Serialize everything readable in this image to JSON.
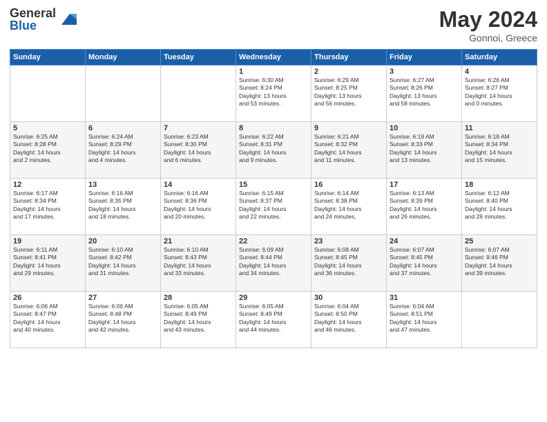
{
  "logo": {
    "general": "General",
    "blue": "Blue"
  },
  "title": "May 2024",
  "location": "Gonnoi, Greece",
  "days_of_week": [
    "Sunday",
    "Monday",
    "Tuesday",
    "Wednesday",
    "Thursday",
    "Friday",
    "Saturday"
  ],
  "weeks": [
    [
      {
        "num": "",
        "info": ""
      },
      {
        "num": "",
        "info": ""
      },
      {
        "num": "",
        "info": ""
      },
      {
        "num": "1",
        "info": "Sunrise: 6:30 AM\nSunset: 8:24 PM\nDaylight: 13 hours\nand 53 minutes."
      },
      {
        "num": "2",
        "info": "Sunrise: 6:29 AM\nSunset: 8:25 PM\nDaylight: 13 hours\nand 56 minutes."
      },
      {
        "num": "3",
        "info": "Sunrise: 6:27 AM\nSunset: 8:26 PM\nDaylight: 13 hours\nand 58 minutes."
      },
      {
        "num": "4",
        "info": "Sunrise: 6:26 AM\nSunset: 8:27 PM\nDaylight: 14 hours\nand 0 minutes."
      }
    ],
    [
      {
        "num": "5",
        "info": "Sunrise: 6:25 AM\nSunset: 8:28 PM\nDaylight: 14 hours\nand 2 minutes."
      },
      {
        "num": "6",
        "info": "Sunrise: 6:24 AM\nSunset: 8:29 PM\nDaylight: 14 hours\nand 4 minutes."
      },
      {
        "num": "7",
        "info": "Sunrise: 6:23 AM\nSunset: 8:30 PM\nDaylight: 14 hours\nand 6 minutes."
      },
      {
        "num": "8",
        "info": "Sunrise: 6:22 AM\nSunset: 8:31 PM\nDaylight: 14 hours\nand 9 minutes."
      },
      {
        "num": "9",
        "info": "Sunrise: 6:21 AM\nSunset: 8:32 PM\nDaylight: 14 hours\nand 11 minutes."
      },
      {
        "num": "10",
        "info": "Sunrise: 6:19 AM\nSunset: 8:33 PM\nDaylight: 14 hours\nand 13 minutes."
      },
      {
        "num": "11",
        "info": "Sunrise: 6:18 AM\nSunset: 8:34 PM\nDaylight: 14 hours\nand 15 minutes."
      }
    ],
    [
      {
        "num": "12",
        "info": "Sunrise: 6:17 AM\nSunset: 8:34 PM\nDaylight: 14 hours\nand 17 minutes."
      },
      {
        "num": "13",
        "info": "Sunrise: 6:16 AM\nSunset: 8:35 PM\nDaylight: 14 hours\nand 18 minutes."
      },
      {
        "num": "14",
        "info": "Sunrise: 6:16 AM\nSunset: 8:36 PM\nDaylight: 14 hours\nand 20 minutes."
      },
      {
        "num": "15",
        "info": "Sunrise: 6:15 AM\nSunset: 8:37 PM\nDaylight: 14 hours\nand 22 minutes."
      },
      {
        "num": "16",
        "info": "Sunrise: 6:14 AM\nSunset: 8:38 PM\nDaylight: 14 hours\nand 24 minutes."
      },
      {
        "num": "17",
        "info": "Sunrise: 6:13 AM\nSunset: 8:39 PM\nDaylight: 14 hours\nand 26 minutes."
      },
      {
        "num": "18",
        "info": "Sunrise: 6:12 AM\nSunset: 8:40 PM\nDaylight: 14 hours\nand 28 minutes."
      }
    ],
    [
      {
        "num": "19",
        "info": "Sunrise: 6:11 AM\nSunset: 8:41 PM\nDaylight: 14 hours\nand 29 minutes."
      },
      {
        "num": "20",
        "info": "Sunrise: 6:10 AM\nSunset: 8:42 PM\nDaylight: 14 hours\nand 31 minutes."
      },
      {
        "num": "21",
        "info": "Sunrise: 6:10 AM\nSunset: 8:43 PM\nDaylight: 14 hours\nand 33 minutes."
      },
      {
        "num": "22",
        "info": "Sunrise: 6:09 AM\nSunset: 8:44 PM\nDaylight: 14 hours\nand 34 minutes."
      },
      {
        "num": "23",
        "info": "Sunrise: 6:08 AM\nSunset: 8:45 PM\nDaylight: 14 hours\nand 36 minutes."
      },
      {
        "num": "24",
        "info": "Sunrise: 6:07 AM\nSunset: 8:45 PM\nDaylight: 14 hours\nand 37 minutes."
      },
      {
        "num": "25",
        "info": "Sunrise: 6:07 AM\nSunset: 8:46 PM\nDaylight: 14 hours\nand 39 minutes."
      }
    ],
    [
      {
        "num": "26",
        "info": "Sunrise: 6:06 AM\nSunset: 8:47 PM\nDaylight: 14 hours\nand 40 minutes."
      },
      {
        "num": "27",
        "info": "Sunrise: 6:06 AM\nSunset: 8:48 PM\nDaylight: 14 hours\nand 42 minutes."
      },
      {
        "num": "28",
        "info": "Sunrise: 6:05 AM\nSunset: 8:49 PM\nDaylight: 14 hours\nand 43 minutes."
      },
      {
        "num": "29",
        "info": "Sunrise: 6:05 AM\nSunset: 8:49 PM\nDaylight: 14 hours\nand 44 minutes."
      },
      {
        "num": "30",
        "info": "Sunrise: 6:04 AM\nSunset: 8:50 PM\nDaylight: 14 hours\nand 46 minutes."
      },
      {
        "num": "31",
        "info": "Sunrise: 6:04 AM\nSunset: 8:51 PM\nDaylight: 14 hours\nand 47 minutes."
      },
      {
        "num": "",
        "info": ""
      }
    ]
  ]
}
